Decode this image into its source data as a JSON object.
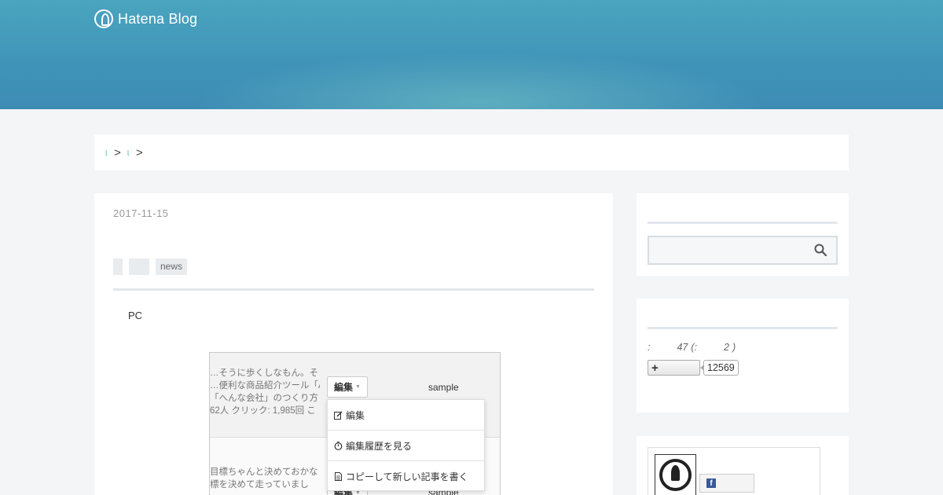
{
  "header": {
    "logo_text": "Hatena Blog"
  },
  "breadcrumb": {
    "links": [
      "",
      ""
    ],
    "separator": ">"
  },
  "entry": {
    "date": "2017-11-15",
    "categories": [
      "",
      "",
      "news"
    ],
    "body_text": "PC",
    "screenshot": {
      "row1_snippet": [
        "…そうに歩くしなもん。そ",
        "…便利な商品紹介ツール「A",
        "「へんな会社」のつくり方",
        "62人 クリック: 1,985回 こ"
      ],
      "row2_snippet": [
        "目標ちゃんと決めておかな",
        "標を決めて走っていまし",
        "…"
      ],
      "edit_label": "編集",
      "sample_label": "sample",
      "menu_items": [
        {
          "icon": "edit-icon",
          "label": "編集"
        },
        {
          "icon": "stopwatch-icon",
          "label": "編集履歴を見る"
        },
        {
          "icon": "document-icon",
          "label": "コピーして新しい記事を書く"
        }
      ]
    }
  },
  "sidebar": {
    "search": {
      "placeholder": ""
    },
    "stats": {
      "prefix": ":",
      "entries": "47",
      "open": "(:",
      "days": "2",
      "close": ")"
    },
    "follow": {
      "count": "12569"
    }
  }
}
